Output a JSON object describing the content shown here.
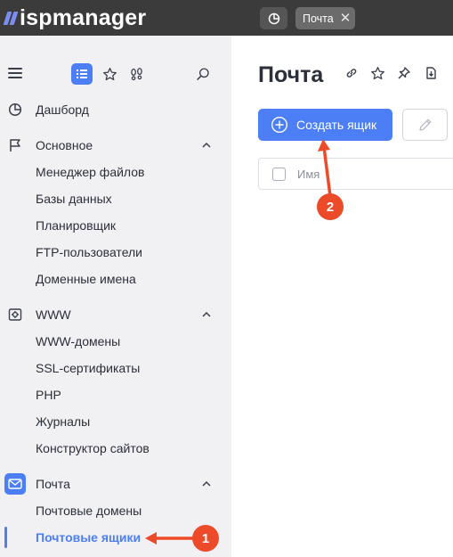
{
  "app": {
    "logo_text": "ispmanager"
  },
  "topbar": {
    "tab_label": "Почта"
  },
  "sidebar": {
    "items": [
      {
        "label": "Дашборд",
        "icon": "pie-chart-icon"
      },
      {
        "label": "Основное",
        "icon": "flag-icon"
      },
      {
        "label": "Менеджер файлов"
      },
      {
        "label": "Базы данных"
      },
      {
        "label": "Планировщик"
      },
      {
        "label": "FTP-пользователи"
      },
      {
        "label": "Доменные имена"
      },
      {
        "label": "WWW",
        "icon": "gear-icon"
      },
      {
        "label": "WWW-домены"
      },
      {
        "label": "SSL-сертификаты"
      },
      {
        "label": "PHP"
      },
      {
        "label": "Журналы"
      },
      {
        "label": "Конструктор сайтов"
      },
      {
        "label": "Почта",
        "icon": "mail-icon"
      },
      {
        "label": "Почтовые домены"
      },
      {
        "label": "Почтовые ящики"
      }
    ]
  },
  "main": {
    "title": "Почта",
    "create_button_label": "Создать ящик",
    "table": {
      "columns": [
        "Имя"
      ]
    }
  },
  "annotations": {
    "badge_1": "1",
    "badge_2": "2",
    "color": "#ec4a28"
  },
  "colors": {
    "accent": "#4c7ef5",
    "topbar": "#3b3b3b",
    "sidebar": "#f1f1f3"
  }
}
